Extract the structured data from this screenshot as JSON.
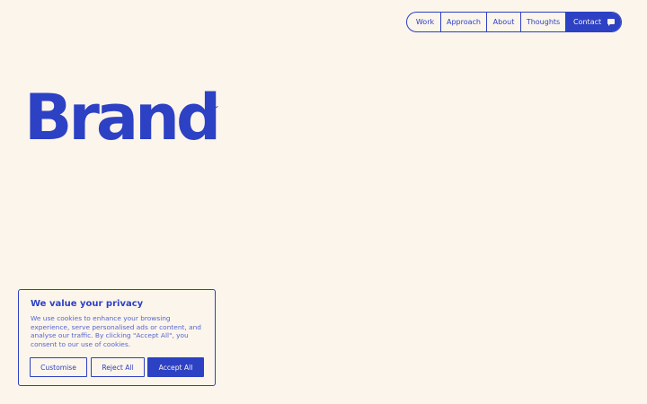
{
  "nav": {
    "items": [
      {
        "label": "Work"
      },
      {
        "label": "Approach"
      },
      {
        "label": "About"
      },
      {
        "label": "Thoughts"
      }
    ],
    "contact": {
      "label": "Contact",
      "icon": "chat-bubble-icon"
    }
  },
  "logo": {
    "text": "Brand"
  },
  "cookie": {
    "title": "We value your privacy",
    "body": "We use cookies to enhance your browsing experience, serve personalised ads or content, and analyse our traffic. By clicking \"Accept All\", you consent to our use of cookies.",
    "buttons": {
      "customise": "Customise",
      "reject": "Reject All",
      "accept": "Accept All"
    }
  },
  "colors": {
    "background": "#fcf5ec",
    "brand": "#2d41c4",
    "body_text": "#5566cf"
  }
}
